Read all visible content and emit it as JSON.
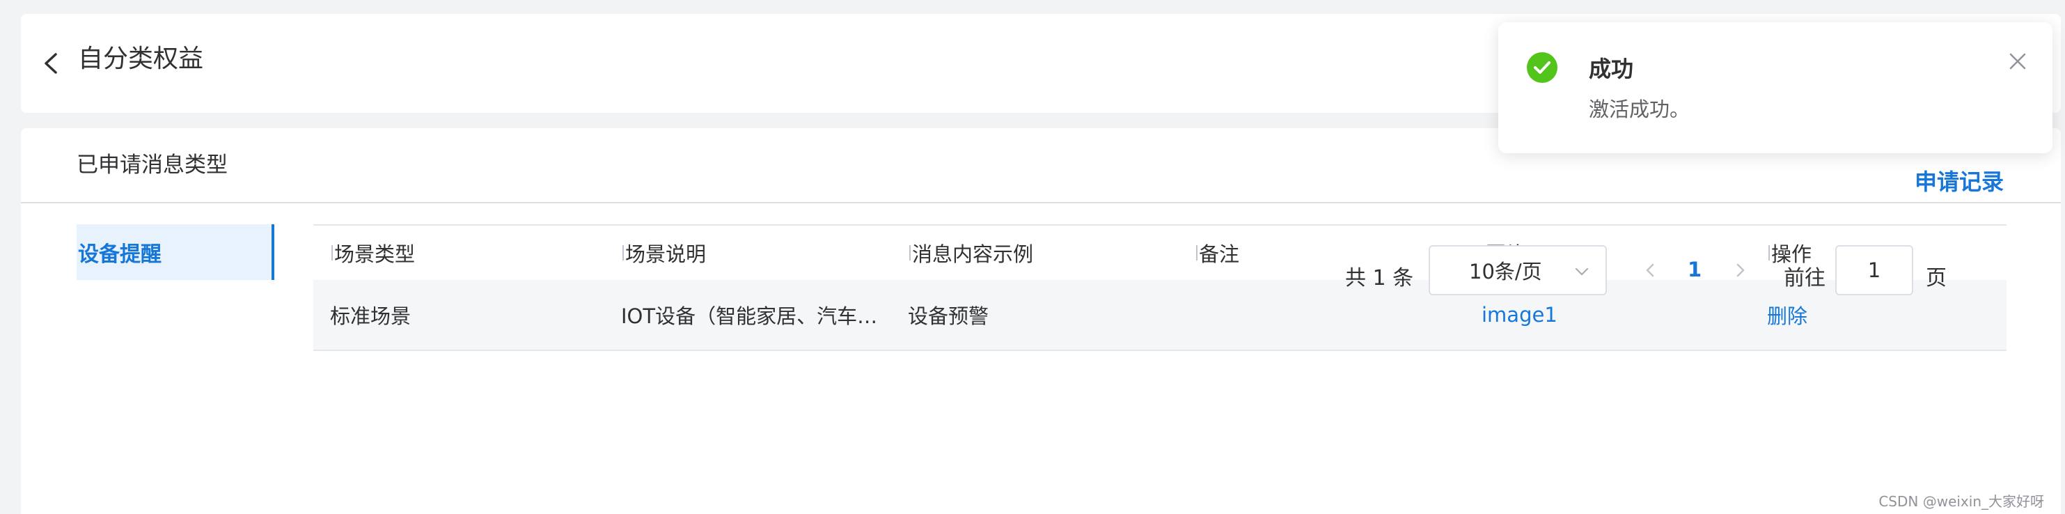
{
  "header": {
    "title": "自分类权益"
  },
  "section": {
    "title": "已申请消息类型",
    "apply_record_label": "申请记录"
  },
  "side_tabs": [
    {
      "label": "设备提醒",
      "active": true
    }
  ],
  "table": {
    "columns": [
      "场景类型",
      "场景说明",
      "消息内容示例",
      "备注",
      "图片",
      "操作"
    ],
    "rows": [
      {
        "scene_type": "标准场景",
        "scene_desc": "IOT设备（智能家居、汽车…",
        "message_example": "设备预警",
        "remark": "",
        "image": "image1",
        "action": "删除"
      }
    ]
  },
  "pagination": {
    "total_label": "共 1 条",
    "page_size": "10条/页",
    "current_page": "1",
    "goto_prefix": "前往",
    "goto_value": "1",
    "goto_suffix": "页"
  },
  "toast": {
    "title": "成功",
    "message": "激活成功。"
  },
  "watermark": "CSDN @weixin_大家好呀",
  "colors": {
    "accent": "#1677d9",
    "success": "#52c41a",
    "background": "#f2f3f5"
  }
}
